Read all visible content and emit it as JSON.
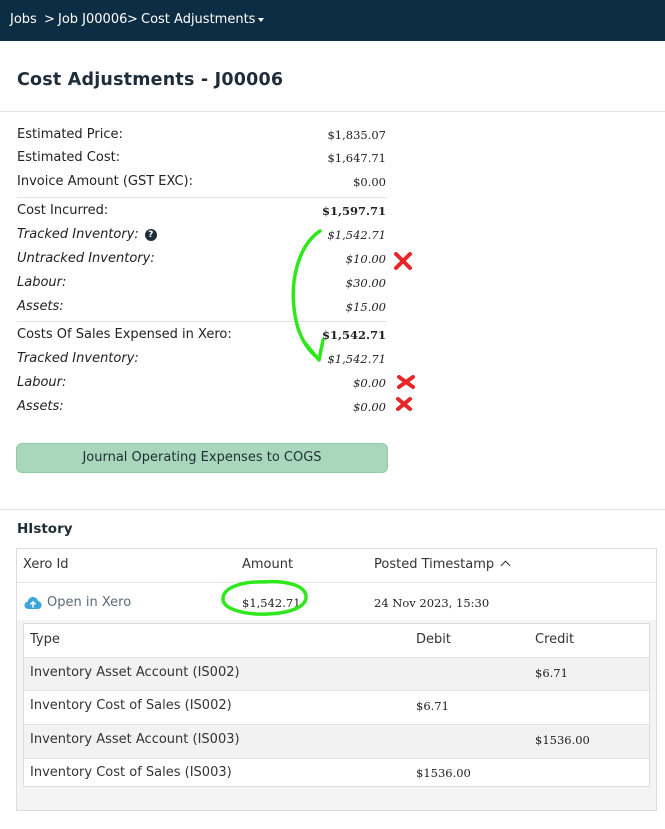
{
  "breadcrumb": {
    "jobs": "Jobs",
    "job": "Job J00006",
    "current": "Cost Adjustments",
    "separator": ">"
  },
  "page": {
    "title": "Cost Adjustments - J00006"
  },
  "summary": {
    "estimated_price": {
      "label": "Estimated Price:",
      "value": "$1,835.07"
    },
    "estimated_cost": {
      "label": "Estimated Cost:",
      "value": "$1,647.71"
    },
    "invoice_amount": {
      "label": "Invoice Amount (GST EXC):",
      "value": "$0.00"
    }
  },
  "cost_incurred": {
    "label": "Cost Incurred:",
    "value": "$1,597.71",
    "tracked_inventory": {
      "label": "Tracked Inventory:",
      "value": "$1,542.71",
      "help_icon": "question-circle-icon"
    },
    "untracked_inventory": {
      "label": "Untracked Inventory:",
      "value": "$10.00"
    },
    "labour": {
      "label": "Labour:",
      "value": "$30.00"
    },
    "assets": {
      "label": "Assets:",
      "value": "$15.00"
    }
  },
  "cogs_expensed": {
    "label": "Costs Of Sales Expensed in Xero:",
    "value": "$1,542.71",
    "tracked_inventory": {
      "label": "Tracked Inventory:",
      "value": "$1,542.71"
    },
    "labour": {
      "label": "Labour:",
      "value": "$0.00"
    },
    "assets": {
      "label": "Assets:",
      "value": "$0.00"
    }
  },
  "journal_button": {
    "label": "Journal Operating Expenses to COGS"
  },
  "history": {
    "title": "HIstory",
    "columns": {
      "xero_id": "Xero Id",
      "amount": "Amount",
      "posted": "Posted Timestamp"
    },
    "entry": {
      "link_label": "Open in Xero",
      "link_icon": "cloud-upload-icon",
      "amount": "$1,542.71",
      "timestamp": "24 Nov 2023, 15:30"
    },
    "lines": {
      "columns": {
        "type": "Type",
        "debit": "Debit",
        "credit": "Credit"
      },
      "rows": [
        {
          "type": "Inventory Asset Account (IS002)",
          "debit": "",
          "credit": "$6.71"
        },
        {
          "type": "Inventory Cost of Sales (IS002)",
          "debit": "$6.71",
          "credit": ""
        },
        {
          "type": "Inventory Asset Account (IS003)",
          "debit": "",
          "credit": "$1536.00"
        },
        {
          "type": "Inventory Cost of Sales (IS003)",
          "debit": "$1536.00",
          "credit": ""
        }
      ]
    }
  },
  "colors": {
    "navbar": "#0d2d44",
    "button": "#a9d7bb",
    "annotation_green": "#2ee81c",
    "annotation_red": "#e8262a",
    "icon_blue": "#3aa5dc"
  }
}
